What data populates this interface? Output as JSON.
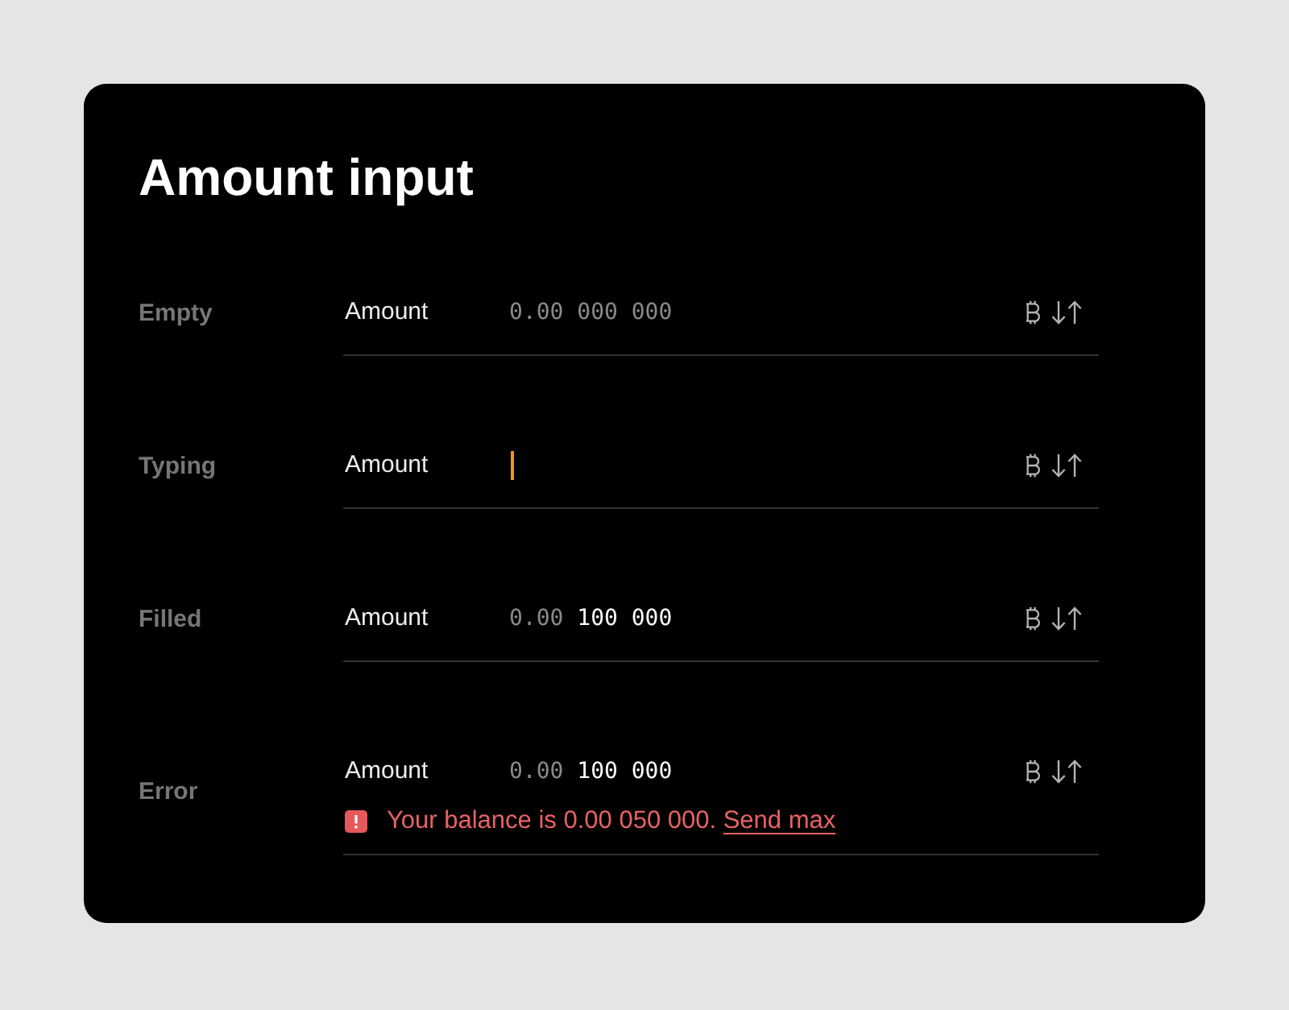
{
  "title": "Amount input",
  "rows": [
    {
      "state": "Empty",
      "kind": "empty",
      "label": "Amount",
      "placeholder": "0.00 000 000",
      "focused": false
    },
    {
      "state": "Typing",
      "kind": "typing",
      "label": "Amount",
      "focused": true
    },
    {
      "state": "Filled",
      "kind": "filled",
      "label": "Amount",
      "value_prefix": "0.00",
      "value": "100 000",
      "focused": false
    },
    {
      "state": "Error",
      "kind": "error",
      "label": "Amount",
      "value_prefix": "0.00",
      "value": "100 000",
      "focused": false,
      "error": {
        "message": "Your balance is 0.00 050 000.",
        "link": "Send max"
      }
    }
  ]
}
